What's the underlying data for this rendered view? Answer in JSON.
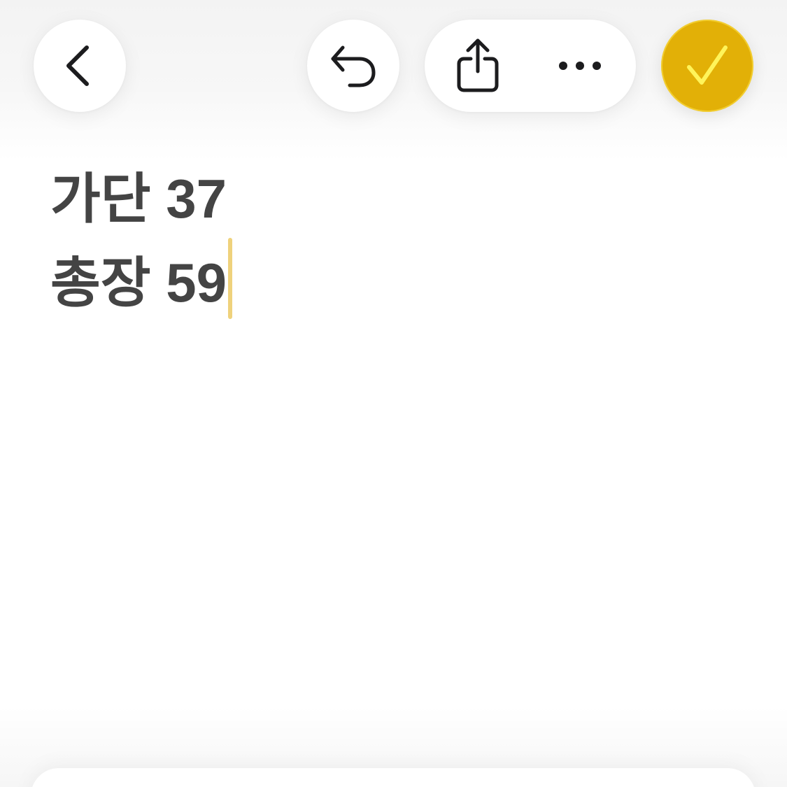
{
  "toolbar": {
    "back_icon": "chevron-left-icon",
    "undo_icon": "undo-arrow-icon",
    "share_icon": "share-icon",
    "more_icon": "ellipsis-icon",
    "done_icon": "checkmark-icon"
  },
  "note": {
    "lines": [
      "가단 37",
      "총장 59"
    ]
  },
  "colors": {
    "accent": "#e2b007",
    "checkmark": "#fff45a",
    "text": "#444444",
    "caret": "#efd27c",
    "icon": "#1c1c1e"
  }
}
